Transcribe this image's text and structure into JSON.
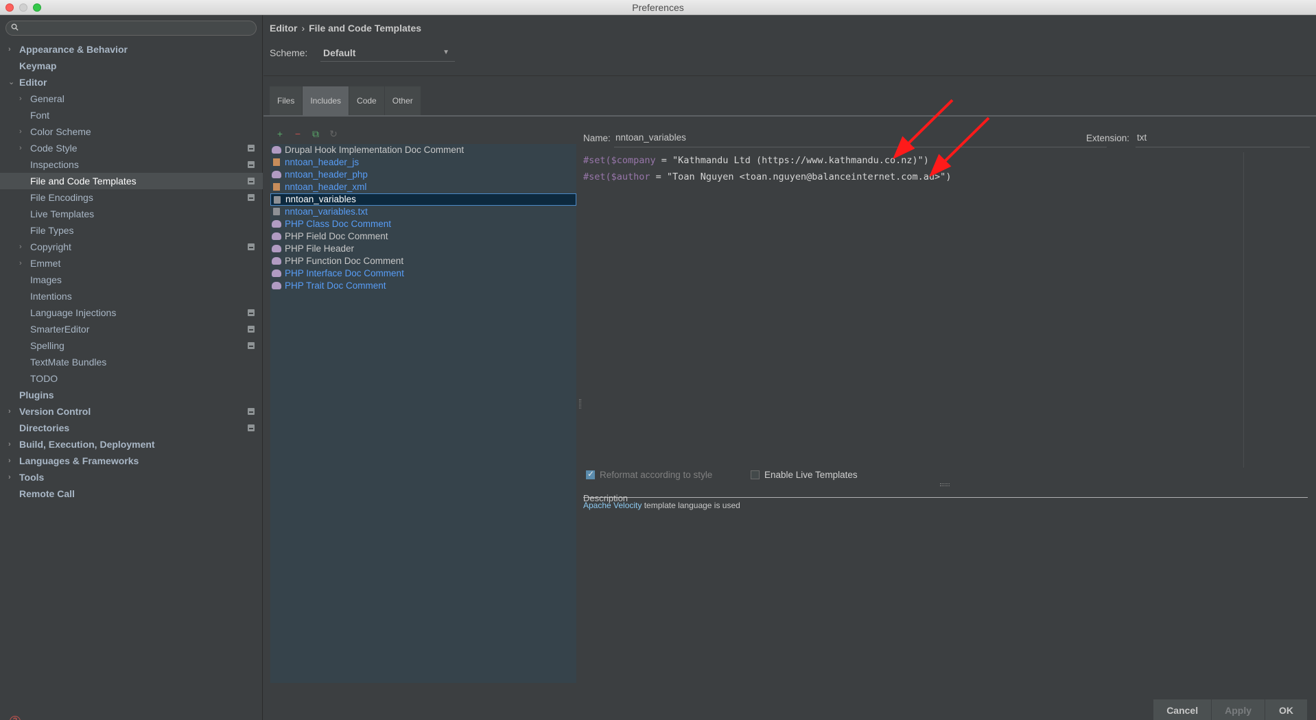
{
  "window": {
    "title": "Preferences"
  },
  "search": {
    "placeholder": ""
  },
  "sidebar": {
    "items": [
      {
        "label": "Appearance & Behavior",
        "level": 0,
        "bold": true,
        "arrow": "right",
        "scope": false
      },
      {
        "label": "Keymap",
        "level": 0,
        "bold": true,
        "arrow": "",
        "scope": false
      },
      {
        "label": "Editor",
        "level": 0,
        "bold": true,
        "arrow": "down",
        "scope": false
      },
      {
        "label": "General",
        "level": 1,
        "bold": false,
        "arrow": "right",
        "scope": false
      },
      {
        "label": "Font",
        "level": 1,
        "bold": false,
        "arrow": "",
        "scope": false
      },
      {
        "label": "Color Scheme",
        "level": 1,
        "bold": false,
        "arrow": "right",
        "scope": false
      },
      {
        "label": "Code Style",
        "level": 1,
        "bold": false,
        "arrow": "right",
        "scope": true
      },
      {
        "label": "Inspections",
        "level": 1,
        "bold": false,
        "arrow": "",
        "scope": true
      },
      {
        "label": "File and Code Templates",
        "level": 1,
        "bold": false,
        "arrow": "",
        "scope": true,
        "selected": true
      },
      {
        "label": "File Encodings",
        "level": 1,
        "bold": false,
        "arrow": "",
        "scope": true
      },
      {
        "label": "Live Templates",
        "level": 1,
        "bold": false,
        "arrow": "",
        "scope": false
      },
      {
        "label": "File Types",
        "level": 1,
        "bold": false,
        "arrow": "",
        "scope": false
      },
      {
        "label": "Copyright",
        "level": 1,
        "bold": false,
        "arrow": "right",
        "scope": true
      },
      {
        "label": "Emmet",
        "level": 1,
        "bold": false,
        "arrow": "right",
        "scope": false
      },
      {
        "label": "Images",
        "level": 1,
        "bold": false,
        "arrow": "",
        "scope": false
      },
      {
        "label": "Intentions",
        "level": 1,
        "bold": false,
        "arrow": "",
        "scope": false
      },
      {
        "label": "Language Injections",
        "level": 1,
        "bold": false,
        "arrow": "",
        "scope": true
      },
      {
        "label": "SmarterEditor",
        "level": 1,
        "bold": false,
        "arrow": "",
        "scope": true
      },
      {
        "label": "Spelling",
        "level": 1,
        "bold": false,
        "arrow": "",
        "scope": true
      },
      {
        "label": "TextMate Bundles",
        "level": 1,
        "bold": false,
        "arrow": "",
        "scope": false
      },
      {
        "label": "TODO",
        "level": 1,
        "bold": false,
        "arrow": "",
        "scope": false
      },
      {
        "label": "Plugins",
        "level": 0,
        "bold": true,
        "arrow": "",
        "scope": false
      },
      {
        "label": "Version Control",
        "level": 0,
        "bold": true,
        "arrow": "right",
        "scope": true
      },
      {
        "label": "Directories",
        "level": 0,
        "bold": true,
        "arrow": "",
        "scope": true
      },
      {
        "label": "Build, Execution, Deployment",
        "level": 0,
        "bold": true,
        "arrow": "right",
        "scope": false
      },
      {
        "label": "Languages & Frameworks",
        "level": 0,
        "bold": true,
        "arrow": "right",
        "scope": false
      },
      {
        "label": "Tools",
        "level": 0,
        "bold": true,
        "arrow": "right",
        "scope": false
      },
      {
        "label": "Remote Call",
        "level": 0,
        "bold": true,
        "arrow": "",
        "scope": false
      }
    ]
  },
  "breadcrumb": {
    "parent": "Editor",
    "separator": "›",
    "current": "File and Code Templates"
  },
  "scheme": {
    "label": "Scheme:",
    "value": "Default"
  },
  "tabs": [
    {
      "label": "Files",
      "active": false
    },
    {
      "label": "Includes",
      "active": true
    },
    {
      "label": "Code",
      "active": false
    },
    {
      "label": "Other",
      "active": false
    }
  ],
  "toolbar": {
    "add": "+",
    "remove": "−",
    "copy": "⧉",
    "reset": "↻"
  },
  "templates": [
    {
      "label": "Drupal Hook Implementation Doc Comment",
      "icon": "php-icon",
      "style": "plain"
    },
    {
      "label": "nntoan_header_js",
      "icon": "js-file-icon",
      "style": "blue"
    },
    {
      "label": "nntoan_header_php",
      "icon": "php-icon",
      "style": "blue"
    },
    {
      "label": "nntoan_header_xml",
      "icon": "xml-file-icon",
      "style": "blue"
    },
    {
      "label": "nntoan_variables",
      "icon": "text-file-icon",
      "style": "selected"
    },
    {
      "label": "nntoan_variables.txt",
      "icon": "text-file-icon",
      "style": "blue"
    },
    {
      "label": "PHP Class Doc Comment",
      "icon": "php-icon",
      "style": "blue"
    },
    {
      "label": "PHP Field Doc Comment",
      "icon": "php-icon",
      "style": "plain"
    },
    {
      "label": "PHP File Header",
      "icon": "php-icon",
      "style": "plain"
    },
    {
      "label": "PHP Function Doc Comment",
      "icon": "php-icon",
      "style": "plain"
    },
    {
      "label": "PHP Interface Doc Comment",
      "icon": "php-icon",
      "style": "blue"
    },
    {
      "label": "PHP Trait Doc Comment",
      "icon": "php-icon",
      "style": "blue"
    }
  ],
  "name": {
    "label": "Name:",
    "value": "nntoan_variables"
  },
  "extension": {
    "label": "Extension:",
    "value": "txt"
  },
  "code": {
    "line1": {
      "kw": "#set(",
      "var": "$company",
      "rest": " = \"Kathmandu Ltd (https://www.kathmandu.co.nz)\")"
    },
    "line2": {
      "kw": "#set(",
      "var": "$author",
      "rest": " = \"Toan Nguyen <toan.nguyen@balanceinternet.com.au>\")"
    }
  },
  "options": {
    "reformat": {
      "label": "Reformat according to style",
      "checked": true
    },
    "live_templates": {
      "label": "Enable Live Templates",
      "checked": false
    }
  },
  "description": {
    "label": "Description",
    "link": "Apache Velocity",
    "text": " template language is used"
  },
  "buttons": {
    "cancel": "Cancel",
    "apply": "Apply",
    "ok": "OK"
  },
  "colors": {
    "annotation_arrow": "#ff1a1a",
    "link": "#589df6"
  }
}
